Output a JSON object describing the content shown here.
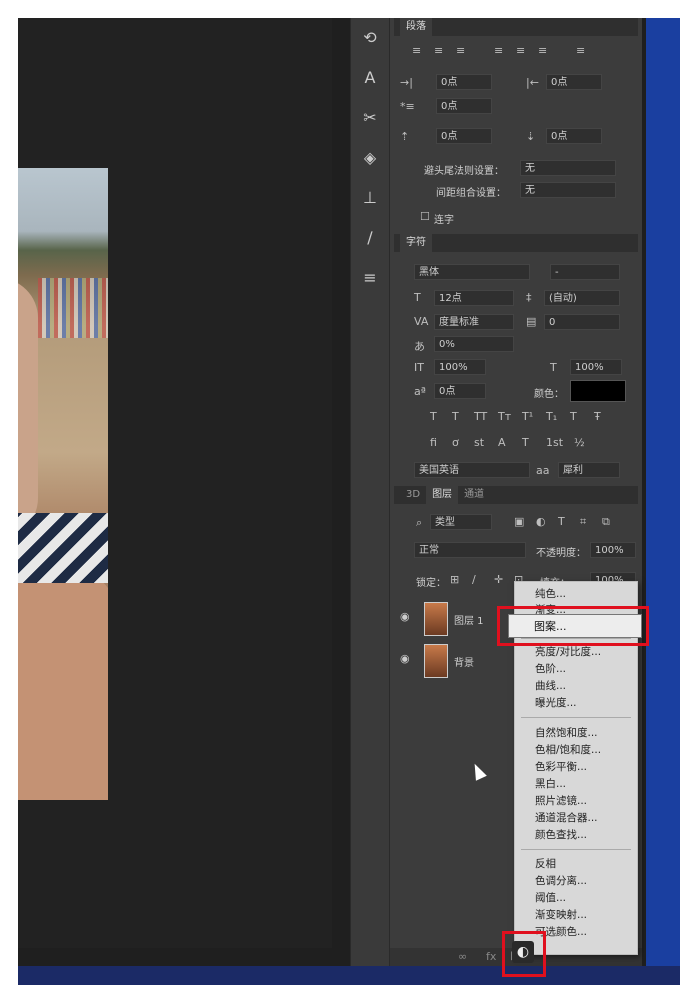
{
  "toolstrip": {
    "icons": [
      "history-icon",
      "character-icon",
      "scissors-icon",
      "cube-icon",
      "stamp-icon",
      "brush-icon",
      "sliders-icon"
    ]
  },
  "paragraph": {
    "header": "段落",
    "indent_left": "0点",
    "indent_right": "0点",
    "indent_first": "0点",
    "space_before": "0点",
    "space_after": "0点",
    "kinsoku_label": "避头尾法则设置：",
    "kinsoku_value": "无",
    "mojikumi_label": "间距组合设置：",
    "mojikumi_value": "无",
    "hyphenate_label": "连字"
  },
  "character": {
    "header": "字符",
    "font_family": "黑体",
    "font_style": "-",
    "font_size": "12点",
    "leading": "(自动)",
    "kerning": "度量标准",
    "tracking": "0",
    "tsume": "0%",
    "vscale": "100%",
    "hscale": "100%",
    "baseline": "0点",
    "color_label": "颜色：",
    "color_value": "#000000",
    "language": "美国英语",
    "aa_label": "aa",
    "aa_value": "犀利"
  },
  "layers": {
    "tabs": [
      "3D",
      "图层",
      "通道"
    ],
    "filter_value": "类型",
    "blend_mode": "正常",
    "opacity_label": "不透明度：",
    "opacity_value": "100%",
    "lock_label": "锁定：",
    "fill_label": "填充：",
    "fill_value": "100%",
    "items": [
      {
        "name": "图层 1"
      },
      {
        "name": "背景"
      }
    ]
  },
  "adjust_menu": {
    "group1": [
      "纯色...",
      "渐变...",
      "图案..."
    ],
    "group2": [
      "亮度/对比度...",
      "色阶...",
      "曲线...",
      "曝光度..."
    ],
    "group3": [
      "自然饱和度...",
      "色相/饱和度...",
      "色彩平衡...",
      "黑白...",
      "照片滤镜...",
      "通道混合器...",
      "颜色查找..."
    ],
    "group4": [
      "反相",
      "色调分离...",
      "阈值...",
      "渐变映射...",
      "可选颜色..."
    ],
    "highlighted": "图案..."
  },
  "bottom": {
    "link_icon": "link-icon",
    "fx_label": "fx",
    "adjust_icon": "adjustment-layer-icon"
  },
  "colors": {
    "highlight_red": "#e0101e",
    "panel_bg": "#3c3c3c",
    "desktop_blue": "#1a3fa0"
  }
}
